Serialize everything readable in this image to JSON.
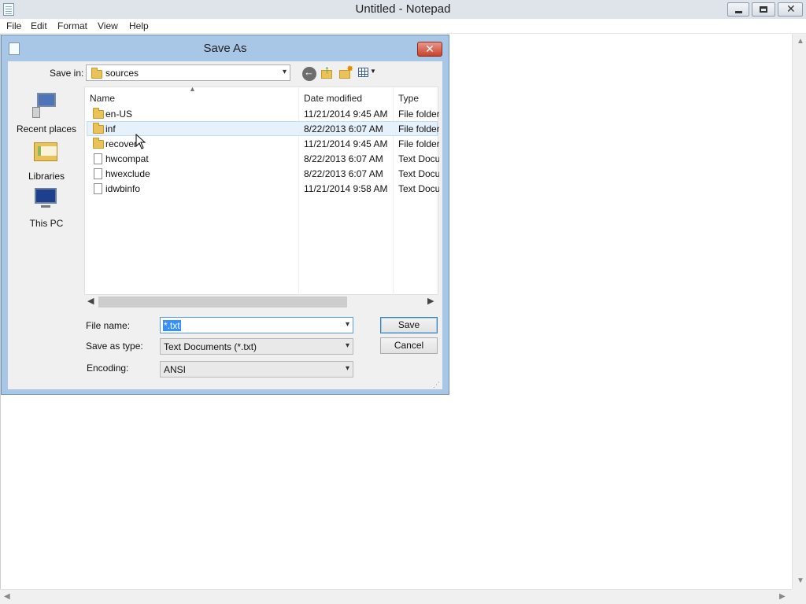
{
  "notepad": {
    "title": "Untitled - Notepad",
    "menu": [
      "File",
      "Edit",
      "Format",
      "View",
      "Help"
    ]
  },
  "dialog": {
    "title": "Save As",
    "close_label": "✕",
    "save_in_label": "Save in:",
    "save_in_value": "sources",
    "places": [
      {
        "label": "Recent places",
        "icon": "recent-places-icon"
      },
      {
        "label": "Libraries",
        "icon": "libraries-icon"
      },
      {
        "label": "This PC",
        "icon": "this-pc-icon"
      }
    ],
    "columns": [
      "Name",
      "Date modified",
      "Type"
    ],
    "files": [
      {
        "name": "en-US",
        "date": "11/21/2014 9:45 AM",
        "type": "File folder",
        "icon": "folder-icon"
      },
      {
        "name": "inf",
        "date": "8/22/2013 6:07 AM",
        "type": "File folder",
        "icon": "folder-icon",
        "selected": true
      },
      {
        "name": "recover",
        "date": "11/21/2014 9:45 AM",
        "type": "File folder",
        "icon": "folder-icon"
      },
      {
        "name": "hwcompat",
        "date": "8/22/2013 6:07 AM",
        "type": "Text Docu",
        "icon": "document-icon"
      },
      {
        "name": "hwexclude",
        "date": "8/22/2013 6:07 AM",
        "type": "Text Docu",
        "icon": "document-icon"
      },
      {
        "name": "idwbinfo",
        "date": "11/21/2014 9:58 AM",
        "type": "Text Docu",
        "icon": "document-icon"
      }
    ],
    "file_name_label": "File name:",
    "file_name_value": "*.txt",
    "save_as_type_label": "Save as type:",
    "save_as_type_value": "Text Documents (*.txt)",
    "encoding_label": "Encoding:",
    "encoding_value": "ANSI",
    "save_button": "Save",
    "cancel_button": "Cancel"
  }
}
